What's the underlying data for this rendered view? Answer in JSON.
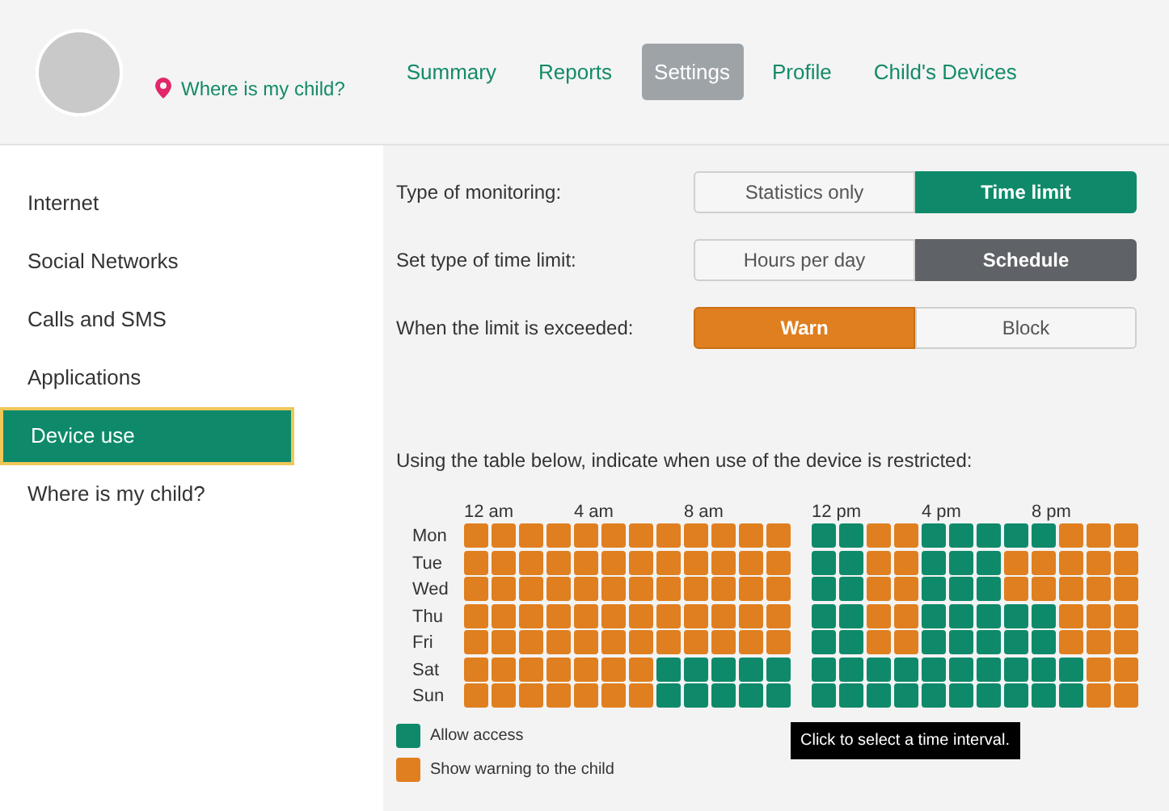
{
  "header": {
    "location_link": "Where is my child?",
    "nav": [
      {
        "label": "Summary",
        "selected": false
      },
      {
        "label": "Reports",
        "selected": false
      },
      {
        "label": "Settings",
        "selected": true
      },
      {
        "label": "Profile",
        "selected": false
      },
      {
        "label": "Child's Devices",
        "selected": false
      }
    ]
  },
  "sidebar": {
    "items": [
      {
        "label": "Internet",
        "selected": false
      },
      {
        "label": "Social Networks",
        "selected": false
      },
      {
        "label": "Calls and SMS",
        "selected": false
      },
      {
        "label": "Applications",
        "selected": false
      },
      {
        "label": "Device use",
        "selected": true
      },
      {
        "label": "Where is my child?",
        "selected": false
      }
    ]
  },
  "settings": [
    {
      "label": "Type of monitoring:",
      "kind": "mode",
      "options": [
        {
          "label": "Statistics only",
          "selected": false
        },
        {
          "label": "Time limit",
          "selected": true
        }
      ]
    },
    {
      "label": "Set type of time limit:",
      "kind": "limit",
      "options": [
        {
          "label": "Hours per day",
          "selected": false
        },
        {
          "label": "Schedule",
          "selected": true
        }
      ]
    },
    {
      "label": "When the limit is exceeded:",
      "kind": "action",
      "options": [
        {
          "label": "Warn",
          "selected": true
        },
        {
          "label": "Block",
          "selected": false
        }
      ]
    }
  ],
  "schedule": {
    "instruction": "Using the table below, indicate when use of the device is restricted:",
    "am_ticks": [
      "12 am",
      "4 am",
      "8 am"
    ],
    "pm_ticks": [
      "12 pm",
      "4 pm",
      "8 pm"
    ],
    "days": [
      {
        "label": "Mon",
        "allowed": [
          false,
          false,
          false,
          false,
          false,
          false,
          false,
          false,
          false,
          false,
          false,
          false,
          true,
          true,
          false,
          false,
          true,
          true,
          true,
          true,
          true,
          false,
          false,
          false
        ]
      },
      {
        "label": "Tue",
        "allowed": [
          false,
          false,
          false,
          false,
          false,
          false,
          false,
          false,
          false,
          false,
          false,
          false,
          true,
          true,
          false,
          false,
          true,
          true,
          true,
          false,
          false,
          false,
          false,
          false
        ]
      },
      {
        "label": "Wed",
        "allowed": [
          false,
          false,
          false,
          false,
          false,
          false,
          false,
          false,
          false,
          false,
          false,
          false,
          true,
          true,
          false,
          false,
          true,
          true,
          true,
          false,
          false,
          false,
          false,
          false
        ]
      },
      {
        "label": "Thu",
        "allowed": [
          false,
          false,
          false,
          false,
          false,
          false,
          false,
          false,
          false,
          false,
          false,
          false,
          true,
          true,
          false,
          false,
          true,
          true,
          true,
          true,
          true,
          false,
          false,
          false
        ]
      },
      {
        "label": "Fri",
        "allowed": [
          false,
          false,
          false,
          false,
          false,
          false,
          false,
          false,
          false,
          false,
          false,
          false,
          true,
          true,
          false,
          false,
          true,
          true,
          true,
          true,
          true,
          false,
          false,
          false
        ]
      },
      {
        "label": "Sat",
        "allowed": [
          false,
          false,
          false,
          false,
          false,
          false,
          false,
          true,
          true,
          true,
          true,
          true,
          true,
          true,
          true,
          true,
          true,
          true,
          true,
          true,
          true,
          true,
          false,
          false
        ]
      },
      {
        "label": "Sun",
        "allowed": [
          false,
          false,
          false,
          false,
          false,
          false,
          false,
          true,
          true,
          true,
          true,
          true,
          true,
          true,
          true,
          true,
          true,
          true,
          true,
          true,
          true,
          true,
          false,
          false
        ]
      }
    ],
    "legend": [
      {
        "label": "Allow access",
        "color": "#0e8a6a"
      },
      {
        "label": "Show warning to the child",
        "color": "#e07f1f"
      }
    ],
    "tooltip": "Click to select a time interval."
  }
}
